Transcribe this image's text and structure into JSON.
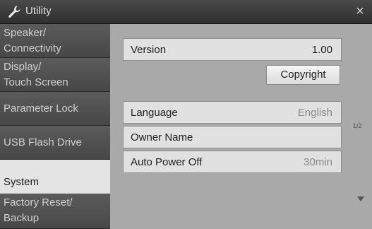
{
  "window": {
    "title": "Utility",
    "title_icon": "wrench-icon",
    "close_label": "×"
  },
  "sidebar": {
    "tabs": [
      {
        "lines": [
          "Speaker/",
          "Connectivity"
        ],
        "active": false
      },
      {
        "lines": [
          "Display/",
          "Touch Screen"
        ],
        "active": false
      },
      {
        "lines": [
          "Parameter Lock"
        ],
        "active": false
      },
      {
        "lines": [
          "USB Flash Drive"
        ],
        "active": false
      },
      {
        "lines": [
          "System"
        ],
        "active": true
      },
      {
        "lines": [
          "Factory Reset/",
          "Backup"
        ],
        "active": false
      }
    ]
  },
  "version": {
    "label": "Version",
    "value": "1.00"
  },
  "copyright_button": "Copyright",
  "settings": [
    {
      "label": "Language",
      "value": "English"
    },
    {
      "label": "Owner Name",
      "value": ""
    },
    {
      "label": "Auto Power Off",
      "value": "30min"
    }
  ],
  "page_indicator": "1/2",
  "colors": {
    "titlebar": "#3a3a3a",
    "tab_inactive": "#505050",
    "tab_active": "#e4e4e4",
    "panel_background": "#a9a9a9",
    "field_background": "#e1e1e1"
  }
}
